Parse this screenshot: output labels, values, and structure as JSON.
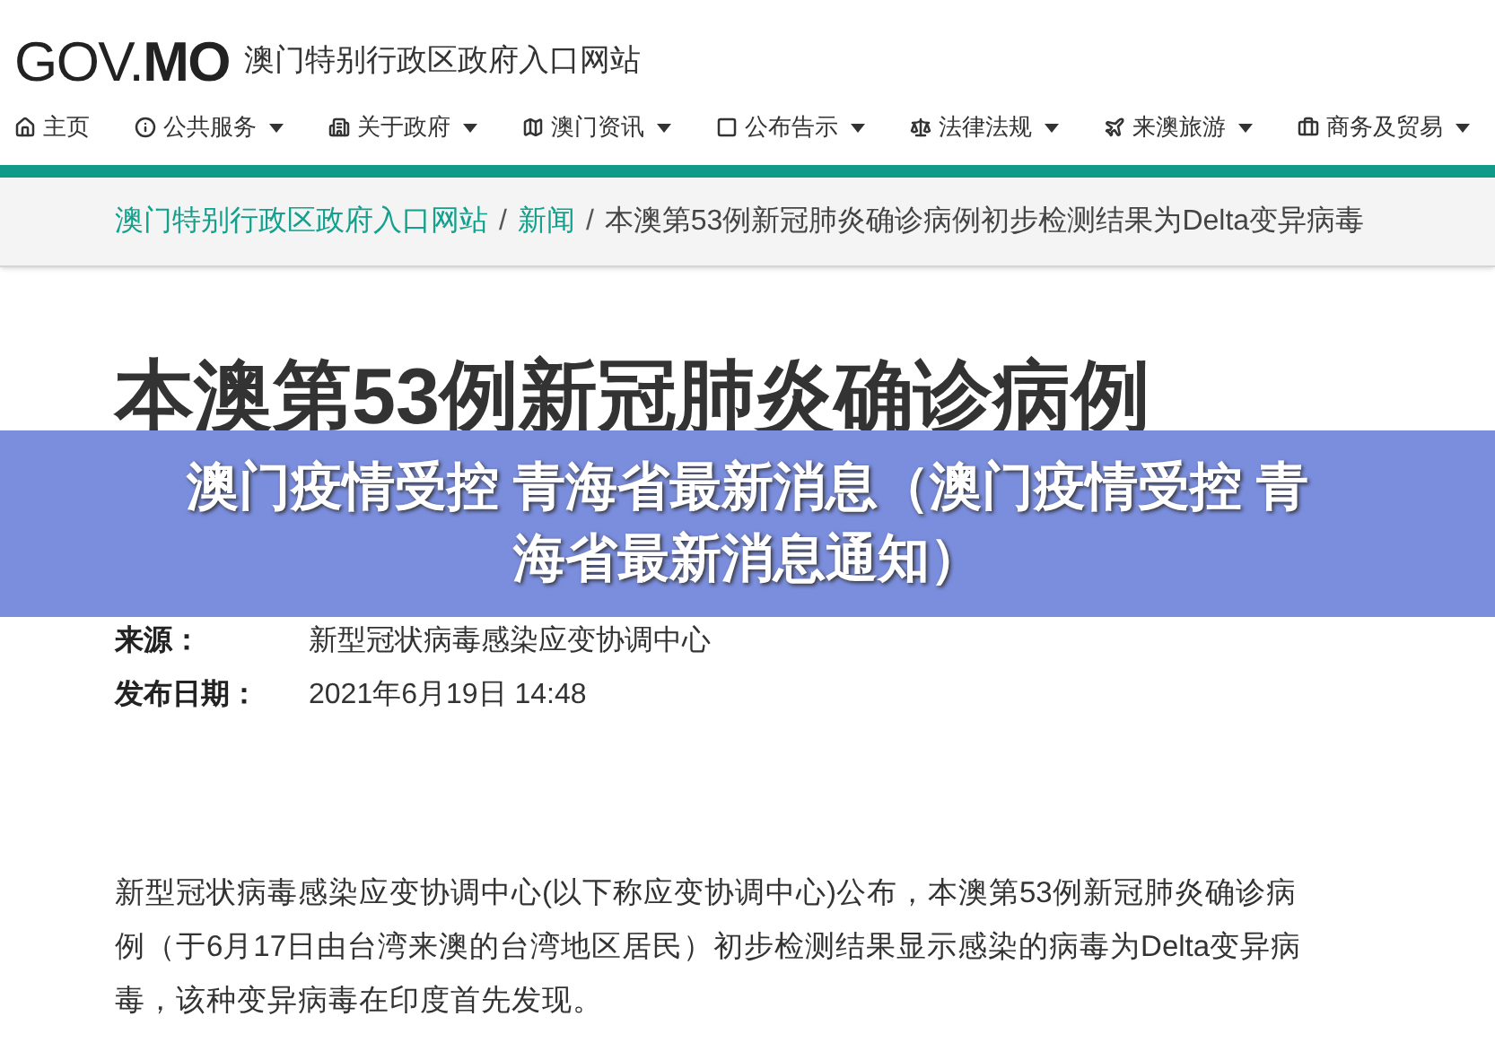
{
  "site": {
    "logo_left": "GOV.",
    "logo_right": "MO",
    "name": "澳门特别行政区政府入口网站"
  },
  "nav": [
    {
      "label": "主页",
      "kind": "home",
      "dropdown": false
    },
    {
      "label": "公共服务",
      "kind": "info",
      "dropdown": true
    },
    {
      "label": "关于政府",
      "kind": "building",
      "dropdown": true
    },
    {
      "label": "澳门资讯",
      "kind": "map",
      "dropdown": true
    },
    {
      "label": "公布告示",
      "kind": "notice",
      "dropdown": true
    },
    {
      "label": "法律法规",
      "kind": "scale",
      "dropdown": true
    },
    {
      "label": "来澳旅游",
      "kind": "plane",
      "dropdown": true
    },
    {
      "label": "商务及贸易",
      "kind": "briefcase",
      "dropdown": true
    }
  ],
  "breadcrumb_separator": "/",
  "breadcrumb": [
    {
      "label": "澳门特别行政区政府入口网站",
      "link": true
    },
    {
      "label": "新闻",
      "link": true
    },
    {
      "label": "本澳第53例新冠肺炎确诊病例初步检测结果为Delta变异病毒",
      "link": false
    }
  ],
  "article": {
    "title": "本澳第53例新冠肺炎确诊病例",
    "meta": [
      {
        "label": "来源：",
        "value": "新型冠状病毒感染应变协调中心"
      },
      {
        "label": "发布日期：",
        "value": "2021年6月19日 14:48"
      }
    ],
    "body": "新型冠状病毒感染应变协调中心(以下称应变协调中心)公布，本澳第53例新冠肺炎确诊病例（于6月17日由台湾来澳的台湾地区居民）初步检测结果显示感染的病毒为Delta变异病毒，该种变异病毒在印度首先发现。"
  },
  "banner": {
    "lines": [
      "澳门疫情受控 青海省最新消息（澳门疫情受控 青",
      "海省最新消息通知）"
    ]
  }
}
